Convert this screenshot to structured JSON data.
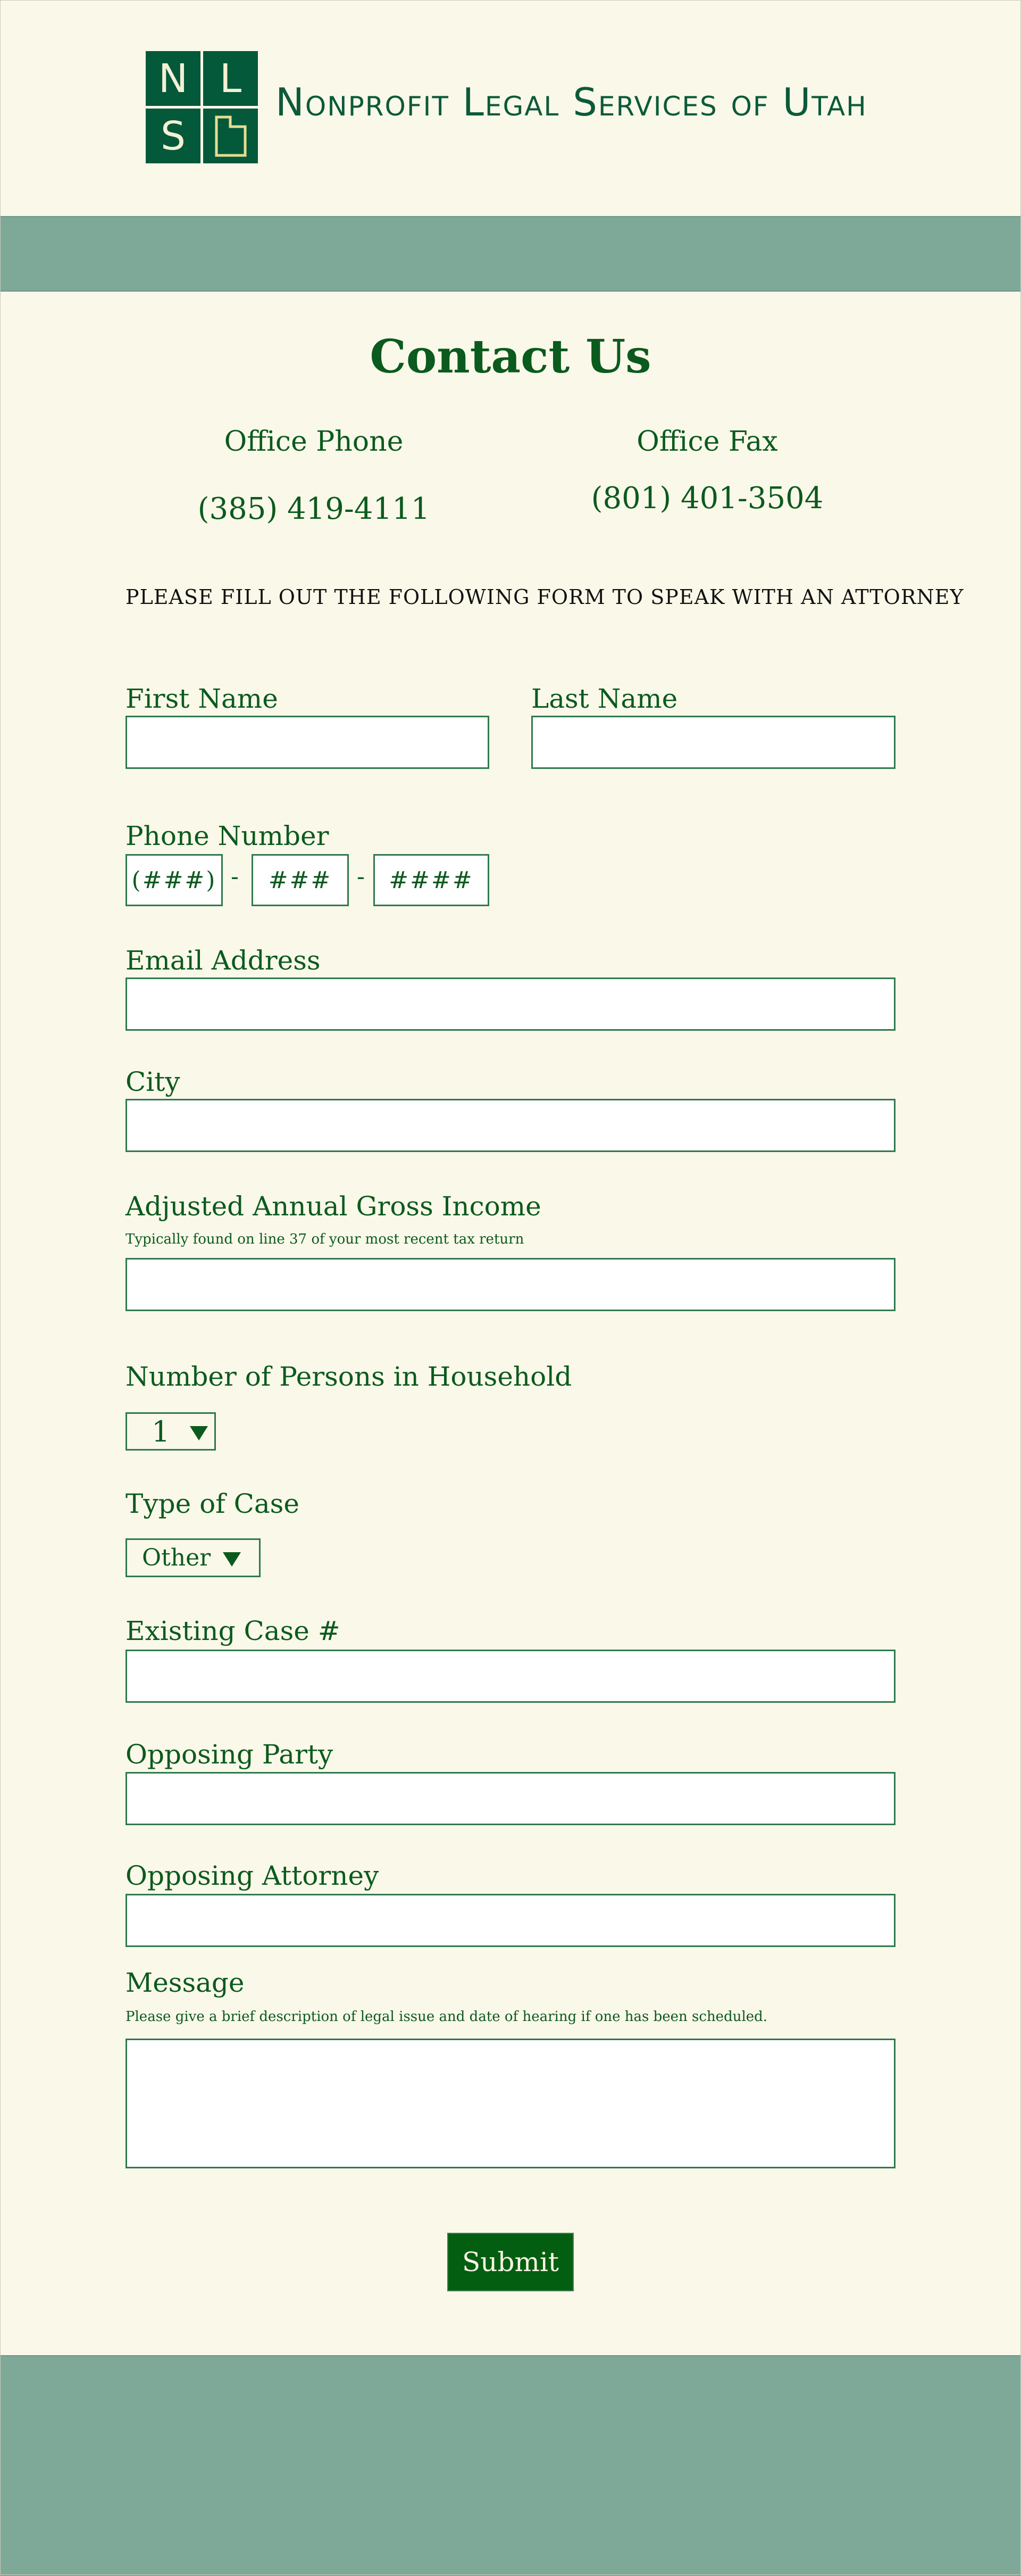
{
  "header": {
    "logo_letters": [
      "N",
      "L",
      "S"
    ],
    "brand_name": "Nonprofit Legal Services of Utah"
  },
  "page_title": "Contact Us",
  "contact": {
    "phone_label": "Office Phone",
    "phone_value": "(385) 419-4111",
    "fax_label": "Office Fax",
    "fax_value": "(801) 401-3504"
  },
  "instruction": "PLEASE FILL OUT THE FOLLOWING FORM TO SPEAK WITH AN ATTORNEY",
  "form": {
    "first_name_label": "First Name",
    "last_name_label": "Last Name",
    "phone_label": "Phone Number",
    "phone_area_placeholder": "(###)",
    "phone_prefix_placeholder": "###",
    "phone_line_placeholder": "####",
    "phone_separator": "-",
    "email_label": "Email Address",
    "city_label": "City",
    "income_label": "Adjusted Annual Gross Income",
    "income_hint": "Typically found on line 37 of your most recent tax return",
    "household_label": "Number of Persons in Household",
    "household_value": "1",
    "case_type_label": "Type of Case",
    "case_type_value": "Other",
    "existing_case_label": "Existing Case #",
    "opposing_party_label": "Opposing Party",
    "opposing_attorney_label": "Opposing Attorney",
    "message_label": "Message",
    "message_hint": "Please give a brief description of legal issue and date of hearing if one has been scheduled.",
    "submit_label": "Submit"
  },
  "colors": {
    "background": "#faf8e9",
    "band": "#7ea998",
    "primary_green": "#0b5a1e",
    "logo_green": "#03593a",
    "submit_green": "#045e11"
  }
}
